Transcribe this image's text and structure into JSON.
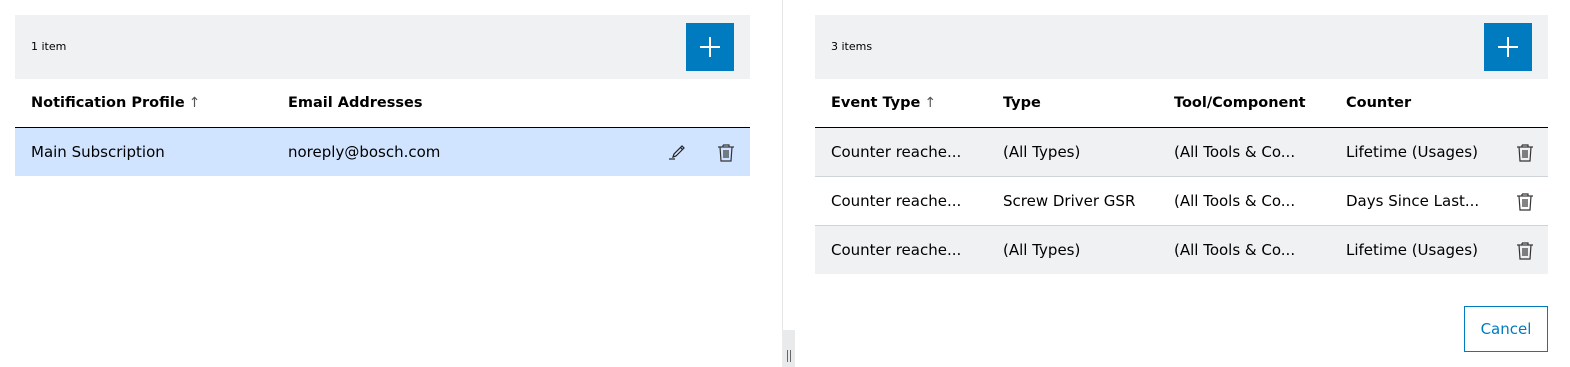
{
  "left_panel": {
    "item_count": "1 item",
    "headers": {
      "profile": "Notification Profile",
      "profile_sort": "↑",
      "email": "Email Addresses"
    },
    "rows": [
      {
        "profile": "Main Subscription",
        "email": "noreply@bosch.com"
      }
    ]
  },
  "right_panel": {
    "item_count": "3 items",
    "headers": {
      "event_type": "Event Type",
      "event_type_sort": "↑",
      "type": "Type",
      "tool": "Tool/Component",
      "counter": "Counter"
    },
    "rows": [
      {
        "event_type": "Counter reache...",
        "type": "(All Types)",
        "tool": "(All Tools & Co...",
        "counter": "Lifetime (Usages)"
      },
      {
        "event_type": "Counter reache...",
        "type": "Screw Driver GSR",
        "tool": "(All Tools & Co...",
        "counter": "Days Since Last..."
      },
      {
        "event_type": "Counter reache...",
        "type": "(All Types)",
        "tool": "(All Tools & Co...",
        "counter": "Lifetime (Usages)"
      }
    ]
  },
  "footer": {
    "cancel_label": "Cancel"
  },
  "colors": {
    "accent": "#007bc0",
    "selected_row": "#d1e4ff",
    "toolbar_bg": "#eff1f2"
  },
  "icons": [
    "add-icon",
    "edit-icon",
    "delete-icon",
    "splitter-handle-icon"
  ]
}
